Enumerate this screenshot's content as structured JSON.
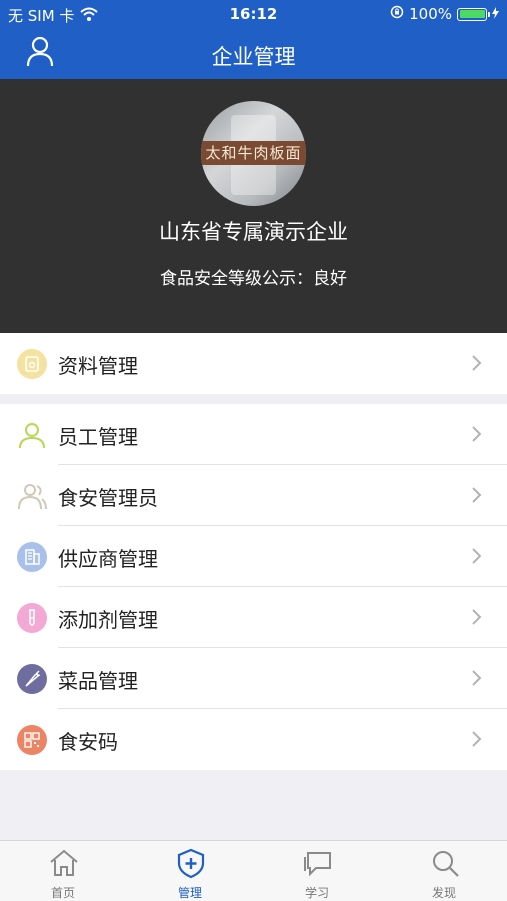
{
  "status_bar": {
    "carrier": "无 SIM 卡",
    "time": "16:12",
    "battery": "100%"
  },
  "nav": {
    "title": "企业管理"
  },
  "profile": {
    "avatar_sign": "太和牛肉板面",
    "name": "山东省专属演示企业",
    "level": "食品安全等级公示：良好"
  },
  "menu_group1": [
    {
      "label": "资料管理",
      "icon": "document-icon",
      "color": "#f6e2a0"
    }
  ],
  "menu_group2": [
    {
      "label": "员工管理",
      "icon": "person-icon",
      "color": "#b6d957"
    },
    {
      "label": "食安管理员",
      "icon": "people-icon",
      "color": "#d8d3c2"
    },
    {
      "label": "供应商管理",
      "icon": "building-icon",
      "color": "#a8c0ea"
    },
    {
      "label": "添加剂管理",
      "icon": "test-tube-icon",
      "color": "#f3a9d4"
    },
    {
      "label": "菜品管理",
      "icon": "carrot-icon",
      "color": "#6f6d9f"
    },
    {
      "label": "食安码",
      "icon": "qr-code-icon",
      "color": "#ec8466"
    }
  ],
  "tabs": [
    {
      "label": "首页",
      "icon": "home-icon"
    },
    {
      "label": "管理",
      "icon": "shield-plus-icon"
    },
    {
      "label": "学习",
      "icon": "chat-icon"
    },
    {
      "label": "发现",
      "icon": "search-icon"
    }
  ],
  "active_tab": "管理",
  "colors": {
    "primary": "#1f5fc6",
    "header_bg": "#313131",
    "page_bg": "#efeff4"
  }
}
